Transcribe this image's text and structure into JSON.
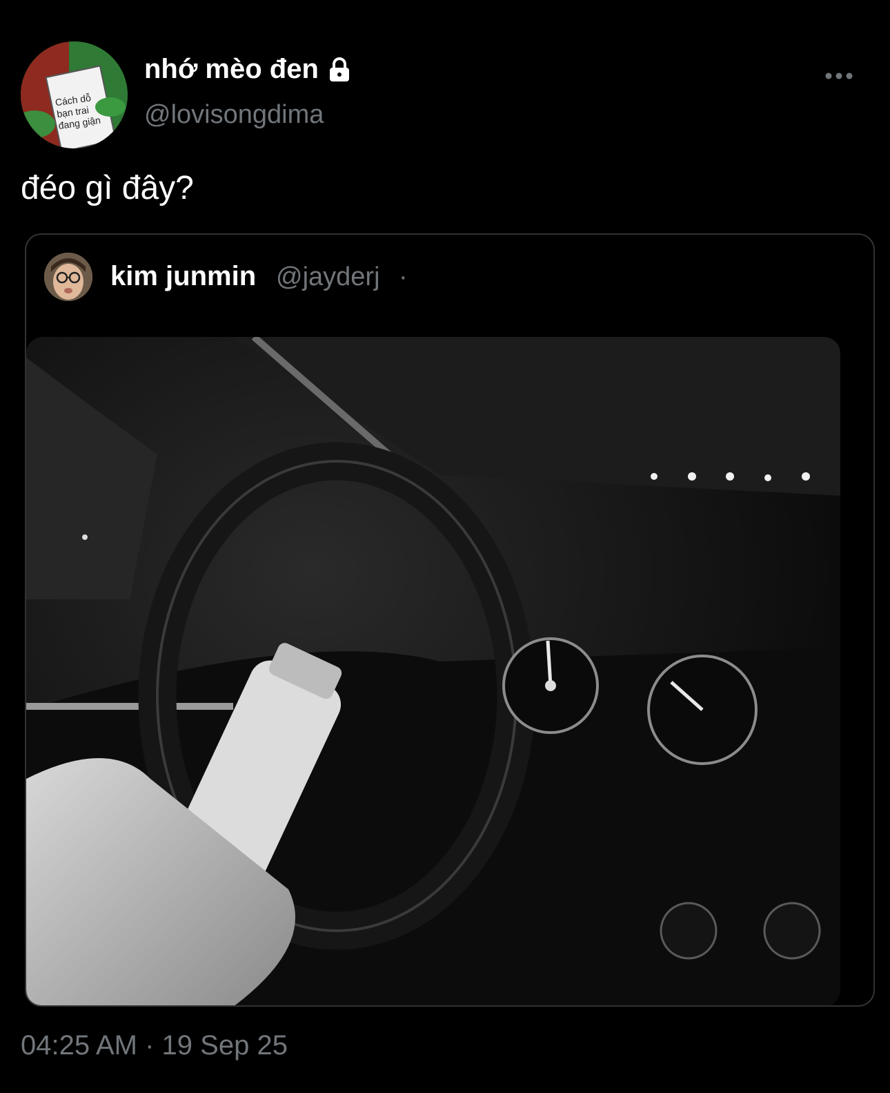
{
  "tweet": {
    "display_name": "nhớ mèo đen",
    "handle": "@lovisongdima",
    "text": "đéo gì đây?",
    "timestamp": "04:25 AM · 19 Sep 25",
    "avatar_book_text": [
      "Cách dỗ",
      "bạn trai",
      "đang giận"
    ],
    "icons": {
      "lock": "lock-icon",
      "more": "more-options-icon"
    }
  },
  "quoted_tweet": {
    "display_name": "kim junmin",
    "handle": "@jayderj",
    "separator": "·",
    "media": "car-interior-night-video-frame"
  },
  "colors": {
    "background": "#000000",
    "primary_text": "#ffffff",
    "secondary_text": "#71767b",
    "border": "#2f3336"
  }
}
